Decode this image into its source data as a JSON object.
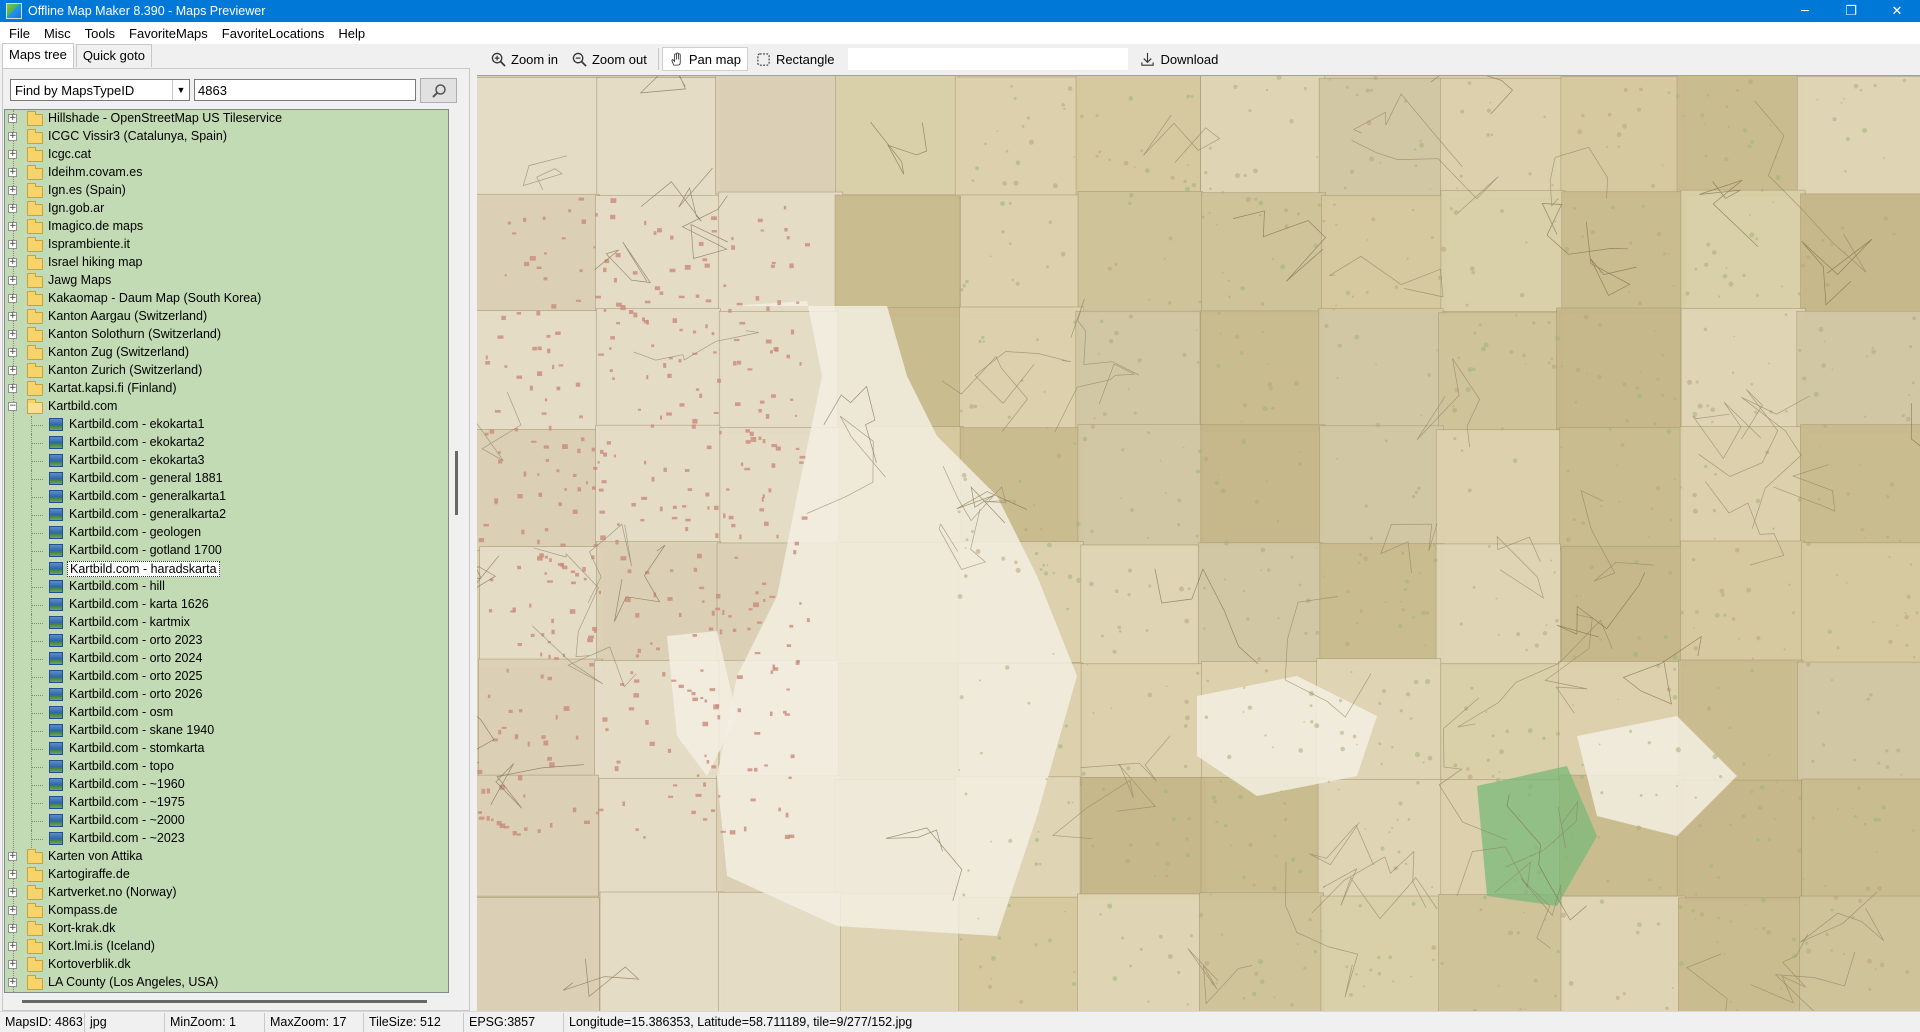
{
  "window": {
    "title": "Offline Map Maker 8.390 - Maps Previewer",
    "minimize_glyph": "─",
    "restore_glyph": "❐",
    "close_glyph": "✕"
  },
  "menu": [
    "File",
    "Misc",
    "Tools",
    "FavoriteMaps",
    "FavoriteLocations",
    "Help"
  ],
  "left_panel": {
    "tabs": [
      "Maps tree",
      "Quick goto"
    ],
    "active_tab": "Maps tree",
    "find_mode": "Find by MapsTypeID",
    "search_value": "4863"
  },
  "tree": {
    "background": "#c3dbb5",
    "items": [
      {
        "level": 0,
        "type": "folder",
        "expander": "+",
        "label": "Hillshade - OpenStreetMap US Tileservice"
      },
      {
        "level": 0,
        "type": "folder",
        "expander": "+",
        "label": "ICGC Vissir3 (Catalunya, Spain)"
      },
      {
        "level": 0,
        "type": "folder",
        "expander": "+",
        "label": "Icgc.cat"
      },
      {
        "level": 0,
        "type": "folder",
        "expander": "+",
        "label": "Ideihm.covam.es"
      },
      {
        "level": 0,
        "type": "folder",
        "expander": "+",
        "label": "Ign.es (Spain)"
      },
      {
        "level": 0,
        "type": "folder",
        "expander": "+",
        "label": "Ign.gob.ar"
      },
      {
        "level": 0,
        "type": "folder",
        "expander": "+",
        "label": "Imagico.de maps"
      },
      {
        "level": 0,
        "type": "folder",
        "expander": "+",
        "label": "Isprambiente.it"
      },
      {
        "level": 0,
        "type": "folder",
        "expander": "+",
        "label": "Israel hiking map"
      },
      {
        "level": 0,
        "type": "folder",
        "expander": "+",
        "label": "Jawg Maps"
      },
      {
        "level": 0,
        "type": "folder",
        "expander": "+",
        "label": "Kakaomap - Daum Map (South Korea)"
      },
      {
        "level": 0,
        "type": "folder",
        "expander": "+",
        "label": "Kanton Aargau (Switzerland)"
      },
      {
        "level": 0,
        "type": "folder",
        "expander": "+",
        "label": "Kanton Solothurn (Switzerland)"
      },
      {
        "level": 0,
        "type": "folder",
        "expander": "+",
        "label": "Kanton Zug (Switzerland)"
      },
      {
        "level": 0,
        "type": "folder",
        "expander": "+",
        "label": "Kanton Zurich (Switzerland)"
      },
      {
        "level": 0,
        "type": "folder",
        "expander": "+",
        "label": "Kartat.kapsi.fi (Finland)"
      },
      {
        "level": 0,
        "type": "folder-open",
        "expander": "−",
        "label": "Kartbild.com"
      },
      {
        "level": 1,
        "type": "map",
        "label": "Kartbild.com - ekokarta1"
      },
      {
        "level": 1,
        "type": "map",
        "label": "Kartbild.com - ekokarta2"
      },
      {
        "level": 1,
        "type": "map",
        "label": "Kartbild.com - ekokarta3"
      },
      {
        "level": 1,
        "type": "map",
        "label": "Kartbild.com - general 1881"
      },
      {
        "level": 1,
        "type": "map",
        "label": "Kartbild.com - generalkarta1"
      },
      {
        "level": 1,
        "type": "map",
        "label": "Kartbild.com - generalkarta2"
      },
      {
        "level": 1,
        "type": "map",
        "label": "Kartbild.com - geologen"
      },
      {
        "level": 1,
        "type": "map",
        "label": "Kartbild.com - gotland 1700"
      },
      {
        "level": 1,
        "type": "map",
        "label": "Kartbild.com - haradskarta",
        "selected": true
      },
      {
        "level": 1,
        "type": "map",
        "label": "Kartbild.com - hill"
      },
      {
        "level": 1,
        "type": "map",
        "label": "Kartbild.com - karta 1626"
      },
      {
        "level": 1,
        "type": "map",
        "label": "Kartbild.com - kartmix"
      },
      {
        "level": 1,
        "type": "map",
        "label": "Kartbild.com - orto 2023"
      },
      {
        "level": 1,
        "type": "map",
        "label": "Kartbild.com - orto 2024"
      },
      {
        "level": 1,
        "type": "map",
        "label": "Kartbild.com - orto 2025"
      },
      {
        "level": 1,
        "type": "map",
        "label": "Kartbild.com - orto 2026"
      },
      {
        "level": 1,
        "type": "map",
        "label": "Kartbild.com - osm"
      },
      {
        "level": 1,
        "type": "map",
        "label": "Kartbild.com - skane 1940"
      },
      {
        "level": 1,
        "type": "map",
        "label": "Kartbild.com - stomkarta"
      },
      {
        "level": 1,
        "type": "map",
        "label": "Kartbild.com - topo"
      },
      {
        "level": 1,
        "type": "map",
        "label": "Kartbild.com - ~1960"
      },
      {
        "level": 1,
        "type": "map",
        "label": "Kartbild.com - ~1975"
      },
      {
        "level": 1,
        "type": "map",
        "label": "Kartbild.com - ~2000"
      },
      {
        "level": 1,
        "type": "map",
        "label": "Kartbild.com - ~2023"
      },
      {
        "level": 0,
        "type": "folder",
        "expander": "+",
        "label": "Karten von Attika"
      },
      {
        "level": 0,
        "type": "folder",
        "expander": "+",
        "label": "Kartogiraffe.de"
      },
      {
        "level": 0,
        "type": "folder",
        "expander": "+",
        "label": "Kartverket.no (Norway)"
      },
      {
        "level": 0,
        "type": "folder",
        "expander": "+",
        "label": "Kompass.de"
      },
      {
        "level": 0,
        "type": "folder",
        "expander": "+",
        "label": "Kort-krak.dk"
      },
      {
        "level": 0,
        "type": "folder",
        "expander": "+",
        "label": "Kort.lmi.is (Iceland)"
      },
      {
        "level": 0,
        "type": "folder",
        "expander": "+",
        "label": "Kortoverblik.dk"
      },
      {
        "level": 0,
        "type": "folder",
        "expander": "+",
        "label": "LA County (Los Angeles, USA)"
      }
    ]
  },
  "toolbar": {
    "zoom_in": "Zoom in",
    "zoom_out": "Zoom out",
    "pan_map": "Pan map",
    "rectangle": "Rectangle",
    "download": "Download",
    "active_tool": "Pan map"
  },
  "map": {
    "description_colors": {
      "paper": "#d9cfac",
      "water_pale": "#f3efe2",
      "land_dark": "#b9a27a",
      "forest": "#9fb47a",
      "red_settlement": "#c98a7a",
      "green_patch": "#79b879"
    }
  },
  "statusbar": {
    "maps_id": "MapsID: 4863",
    "format": "jpg",
    "min_zoom": "MinZoom: 1",
    "max_zoom": "MaxZoom: 17",
    "tile_size": "TileSize: 512",
    "epsg": "EPSG:3857",
    "position": "Longitude=15.386353, Latitude=58.711189, tile=9/277/152.jpg"
  }
}
